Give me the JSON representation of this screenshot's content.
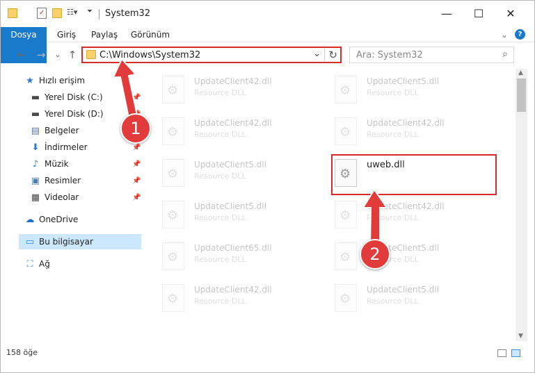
{
  "window": {
    "title": "System32",
    "minimize": "—",
    "maximize": "☐",
    "close": "✕"
  },
  "ribbon": {
    "tabs": [
      "Dosya",
      "Giriş",
      "Paylaş",
      "Görünüm"
    ],
    "collapse": "⌄",
    "help": "?"
  },
  "address": {
    "path": "C:\\Windows\\System32",
    "dropdown": "⌄",
    "refresh": "↻",
    "back": "←",
    "forward": "→",
    "recent": "⌄",
    "up": "↑"
  },
  "search": {
    "placeholder": "Ara: System32",
    "icon": "⌕"
  },
  "nav": {
    "items": [
      {
        "label": "Hızlı erişim",
        "icon": "★",
        "color": "#2d7ad3"
      },
      {
        "label": "Yerel Disk (C:)",
        "icon": "▬",
        "color": "#4a4a4a"
      },
      {
        "label": "Yerel Disk (D:)",
        "icon": "▬",
        "color": "#4a4a4a"
      },
      {
        "label": "Belgeler",
        "icon": "▤",
        "color": "#5a7aa6"
      },
      {
        "label": "İndirmeler",
        "icon": "⬇",
        "color": "#2d7ad3"
      },
      {
        "label": "Müzik",
        "icon": "♪",
        "color": "#2d7ad3"
      },
      {
        "label": "Resimler",
        "icon": "▣",
        "color": "#4a7fb0"
      },
      {
        "label": "Videolar",
        "icon": "▦",
        "color": "#444444"
      },
      {
        "label": "OneDrive",
        "icon": "☁",
        "color": "#1e6fc6"
      },
      {
        "label": "Bu bilgisayar",
        "icon": "▭",
        "color": "#3a8ad6"
      },
      {
        "label": "Ağ",
        "icon": "⛶",
        "color": "#3a8ad6"
      }
    ],
    "pin": "📌"
  },
  "files": {
    "left": [
      {
        "name": "UpdateClient42.dll",
        "type": "Resource DLL"
      },
      {
        "name": "UpdateClient42.dll",
        "type": "Resource DLL"
      },
      {
        "name": "UpdateClient5.dll",
        "type": "Resource DLL"
      },
      {
        "name": "UpdateClient5.dll",
        "type": "Resource DLL"
      },
      {
        "name": "UpdateClient65.dll",
        "type": "Resource DLL"
      },
      {
        "name": "UpdateClient42.dll",
        "type": "Resource DLL"
      }
    ],
    "right": [
      {
        "name": "UpdateClient5.dll",
        "type": "Resource DLL"
      },
      {
        "name": "UpdateClient42.dll",
        "type": "Resource DLL"
      },
      {
        "name": "uweb.dll",
        "type": ""
      },
      {
        "name": "UpdateClient42.dll",
        "type": "Resource DLL"
      },
      {
        "name": "UpdateClient5.dll",
        "type": "Resource DLL"
      },
      {
        "name": "UpdateClient5.dll",
        "type": "Resource DLL"
      }
    ]
  },
  "status": {
    "count": "158 öğe"
  },
  "annotations": {
    "step1": "1",
    "step2": "2",
    "color": "#e23b3b"
  }
}
